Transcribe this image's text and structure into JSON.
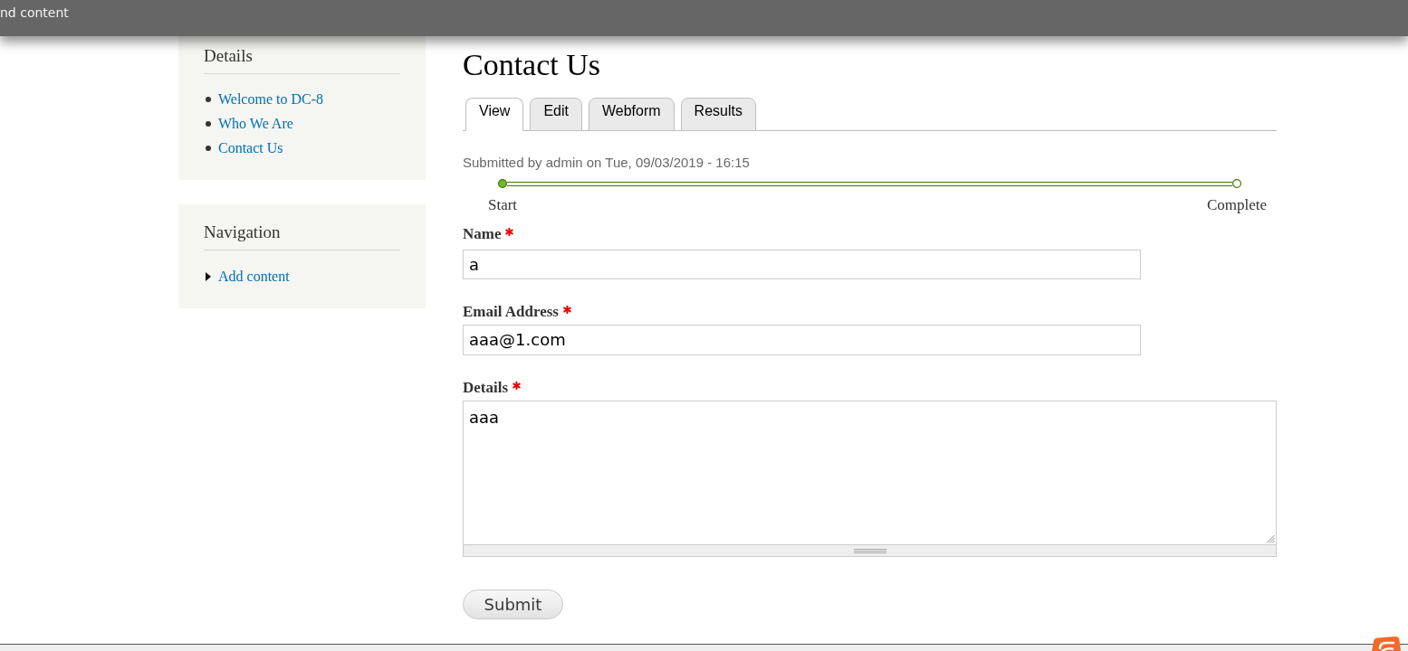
{
  "toolbar": {
    "items": [
      {
        "label": "nd content"
      }
    ]
  },
  "sidebar": {
    "blocks": [
      {
        "title": "Details",
        "links": [
          {
            "label": "Welcome to DC-8",
            "kind": "leaf"
          },
          {
            "label": "Who We Are",
            "kind": "leaf"
          },
          {
            "label": "Contact Us",
            "kind": "leaf"
          }
        ]
      },
      {
        "title": "Navigation",
        "links": [
          {
            "label": "Add content",
            "kind": "collapsed"
          }
        ]
      }
    ]
  },
  "page": {
    "title": "Contact Us",
    "tabs": [
      {
        "label": "View",
        "selected": true
      },
      {
        "label": "Edit",
        "selected": false
      },
      {
        "label": "Webform",
        "selected": false
      },
      {
        "label": "Results",
        "selected": false
      }
    ],
    "submitted": "Submitted by admin on Tue, 09/03/2019 - 16:15",
    "progress": {
      "steps": [
        {
          "label": "Start",
          "done": true
        },
        {
          "label": "Complete",
          "done": false
        }
      ]
    },
    "fields": [
      {
        "kind": "text",
        "label": "Name",
        "required": true,
        "value": "a"
      },
      {
        "kind": "text",
        "label": "Email Address",
        "required": true,
        "value": "aaa@1.com"
      },
      {
        "kind": "textarea",
        "label": "Details",
        "required": true,
        "value": "aaa"
      }
    ],
    "submit": "Submit"
  }
}
